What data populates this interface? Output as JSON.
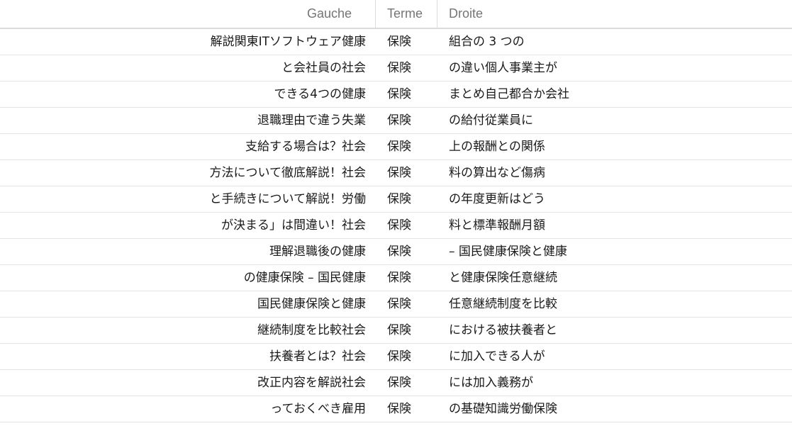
{
  "columns": {
    "left": "Gauche",
    "term": "Terme",
    "right": "Droite"
  },
  "rows": [
    {
      "left": "解説関東ITソフトウェア健康",
      "term": "保険",
      "right": "組合の 3 つの"
    },
    {
      "left": "と会社員の社会",
      "term": "保険",
      "right": "の違い個人事業主が"
    },
    {
      "left": "できる4つの健康",
      "term": "保険",
      "right": "まとめ自己都合か会社"
    },
    {
      "left": "退職理由で違う失業",
      "term": "保険",
      "right": "の給付従業員に"
    },
    {
      "left": "支給する場合は？社会",
      "term": "保険",
      "right": "上の報酬との関係"
    },
    {
      "left": "方法について徹底解説！社会",
      "term": "保険",
      "right": "料の算出など傷病"
    },
    {
      "left": "と手続きについて解説！労働",
      "term": "保険",
      "right": "の年度更新はどう"
    },
    {
      "left": "が決まる」は間違い！社会",
      "term": "保険",
      "right": "料と標準報酬月額"
    },
    {
      "left": "理解退職後の健康",
      "term": "保険",
      "right": "– 国民健康保険と健康"
    },
    {
      "left": "の健康保険 – 国民健康",
      "term": "保険",
      "right": "と健康保険任意継続"
    },
    {
      "left": "国民健康保険と健康",
      "term": "保険",
      "right": "任意継続制度を比較"
    },
    {
      "left": "継続制度を比較社会",
      "term": "保険",
      "right": "における被扶養者と"
    },
    {
      "left": "扶養者とは？社会",
      "term": "保険",
      "right": "に加入できる人が"
    },
    {
      "left": "改正内容を解説社会",
      "term": "保険",
      "right": "には加入義務が"
    },
    {
      "left": "っておくべき雇用",
      "term": "保険",
      "right": "の基礎知識労働保険"
    }
  ]
}
